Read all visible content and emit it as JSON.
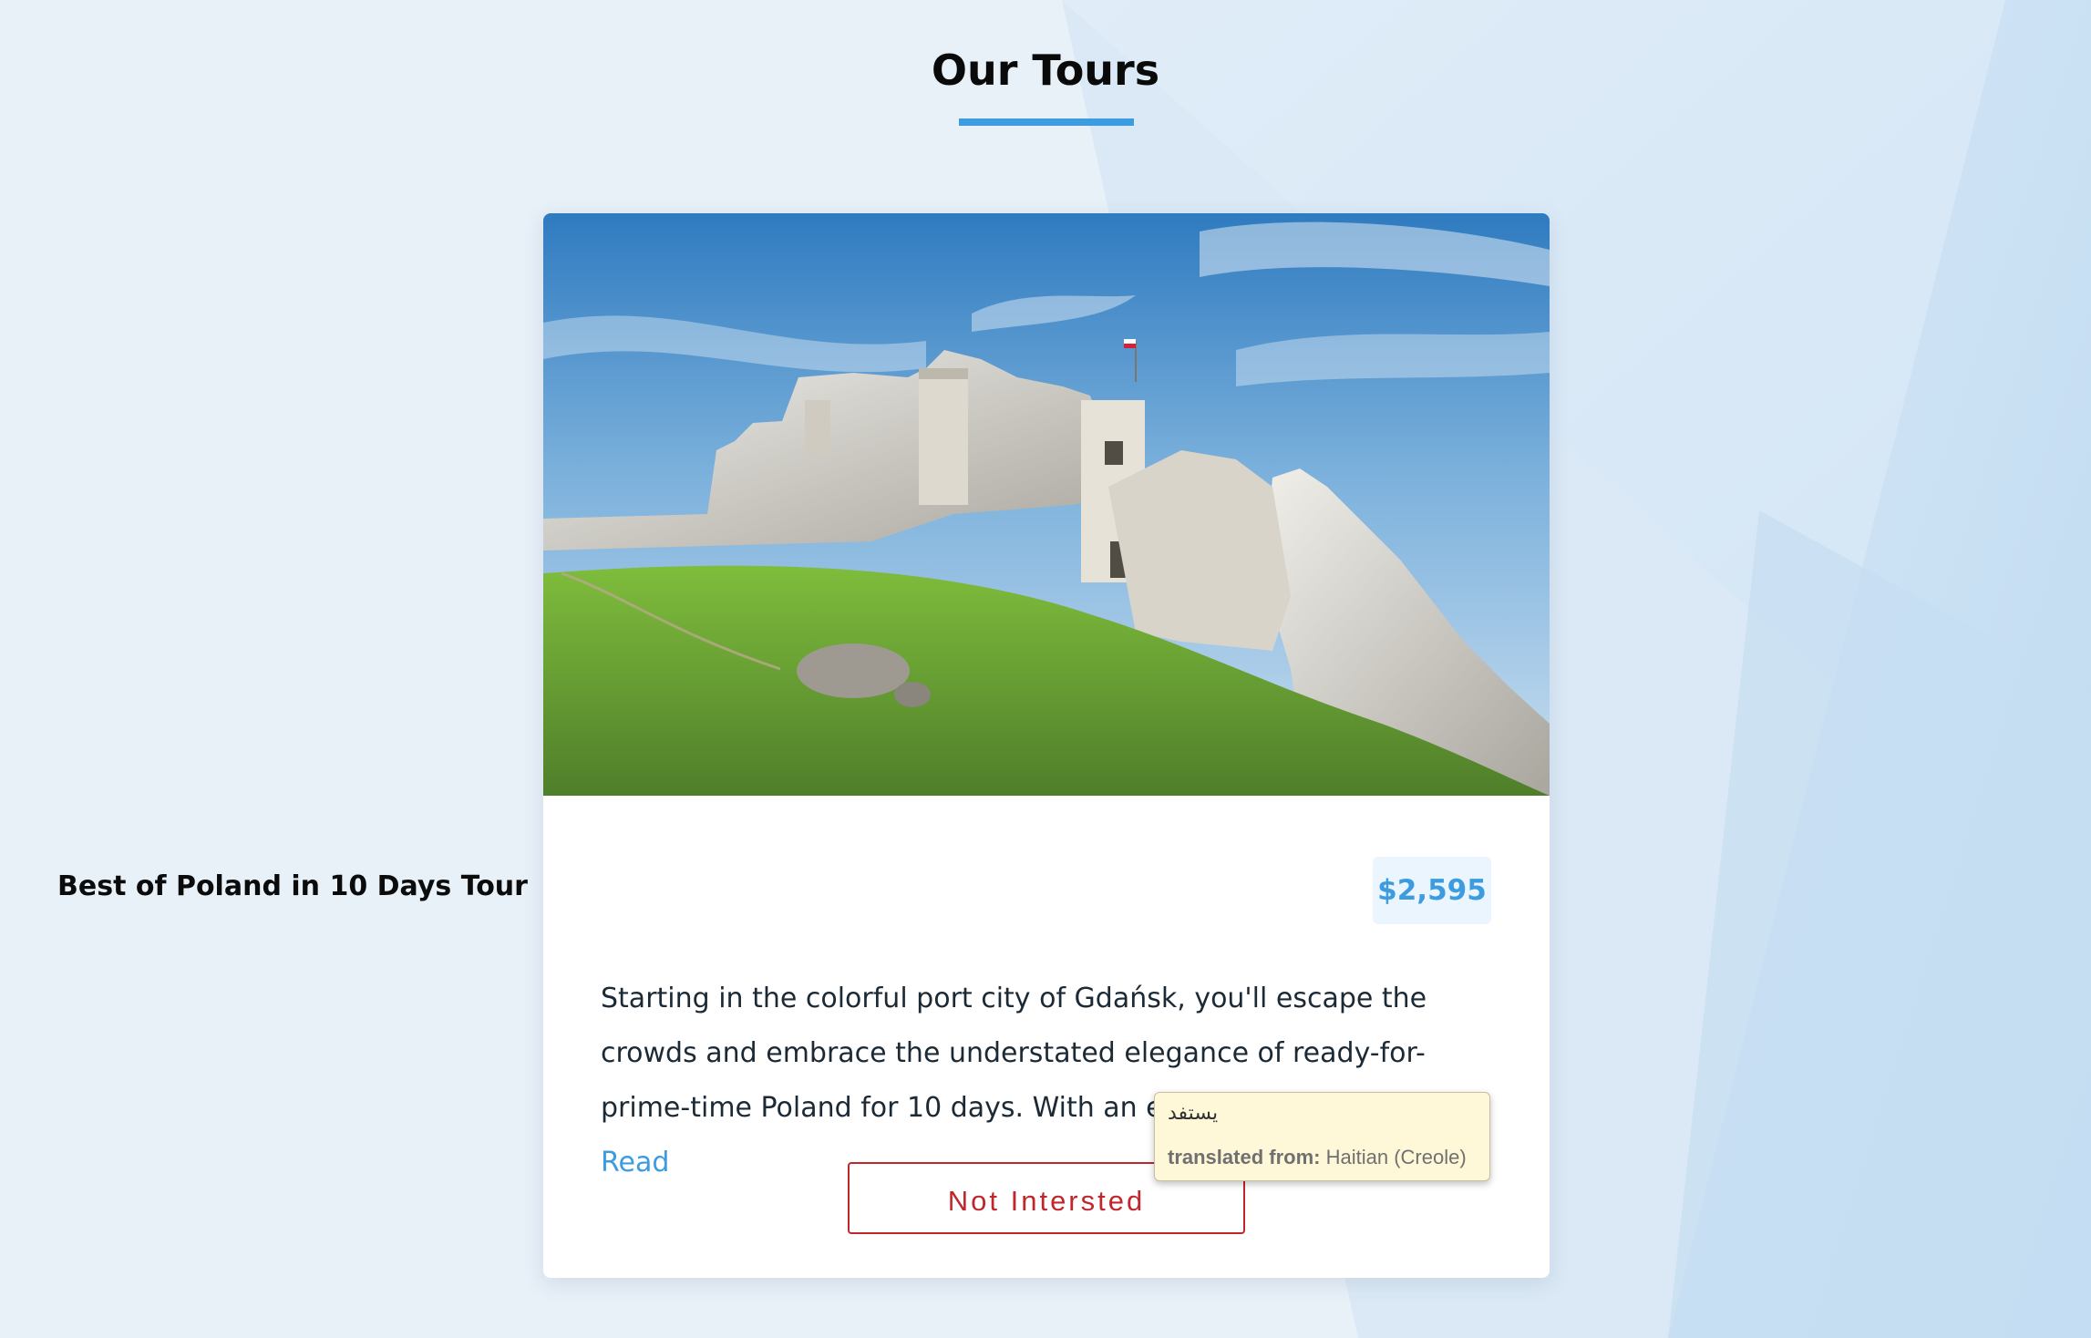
{
  "page": {
    "title": "Our Tours",
    "accent_color": "#3d9be0"
  },
  "tour": {
    "name": "Best of Poland in 10 Days Tour",
    "price": "$2,595",
    "description": "Starting in the colorful port city of Gdańsk, you'll escape the crowds and embrace the understated elegance of ready-for-prime-time Poland for 10 days. With an expert Rick Steves g...",
    "read_more_label": "Read",
    "not_interested_label": "Not Intersted",
    "not_interested_color": "#c0272d",
    "image_icon": "castle-photo"
  },
  "tooltip": {
    "text": "يستفد",
    "label": "translated from:",
    "language": "Haitian (Creole)"
  }
}
